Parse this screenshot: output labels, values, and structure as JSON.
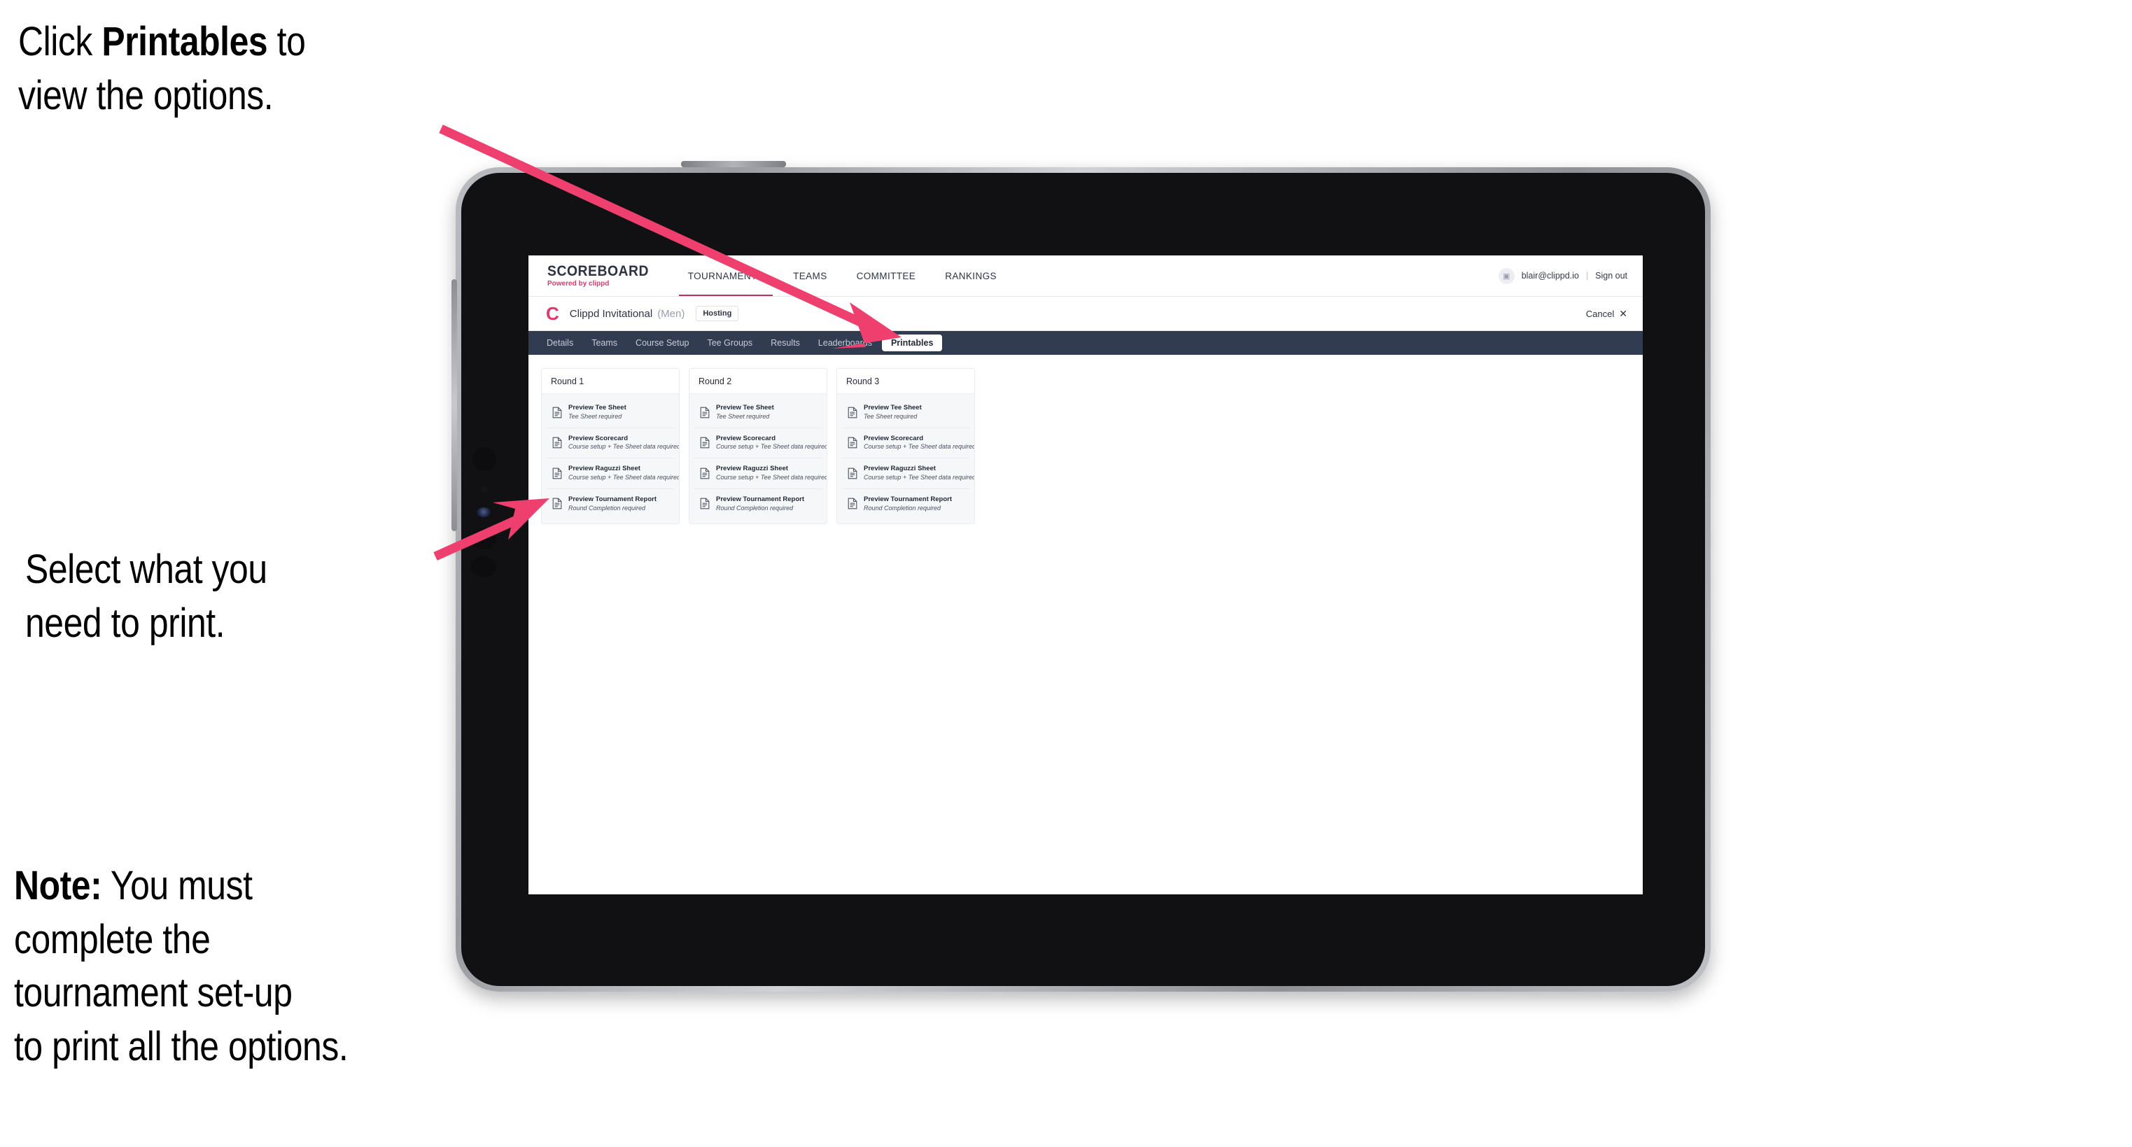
{
  "callouts": {
    "click_line1_prefix": "Click ",
    "click_bold": "Printables",
    "click_line1_suffix": " to",
    "click_line2": "view the options.",
    "select_line1": "Select what you",
    "select_line2": " need to print.",
    "note_bold": "Note:",
    "note_line1_rest": " You must",
    "note_line2": "complete the",
    "note_line3": "tournament set-up",
    "note_line4": "to print all the options."
  },
  "app": {
    "logo": {
      "main": "SCOREBOARD",
      "sub_prefix": "Powered by ",
      "sub_brand": "clippd"
    },
    "topnav": {
      "items": [
        {
          "label": "TOURNAMENTS",
          "active": true
        },
        {
          "label": "TEAMS",
          "active": false
        },
        {
          "label": "COMMITTEE",
          "active": false
        },
        {
          "label": "RANKINGS",
          "active": false
        }
      ],
      "avatar_glyph": "▣",
      "user_email": "blair@clippd.io",
      "separator": "|",
      "sign_out": "Sign out"
    },
    "tournament_bar": {
      "logo_letter": "C",
      "name": "Clippd Invitational",
      "gender": "(Men)",
      "badge": "Hosting",
      "cancel_label": "Cancel",
      "cancel_icon": "✕"
    },
    "section_tabs": [
      {
        "label": "Details",
        "active": false
      },
      {
        "label": "Teams",
        "active": false
      },
      {
        "label": "Course Setup",
        "active": false
      },
      {
        "label": "Tee Groups",
        "active": false
      },
      {
        "label": "Results",
        "active": false
      },
      {
        "label": "Leaderboards",
        "active": false
      },
      {
        "label": "Printables",
        "active": true
      }
    ],
    "rounds": [
      {
        "title": "Round 1",
        "items": [
          {
            "title": "Preview Tee Sheet",
            "sub": "Tee Sheet required"
          },
          {
            "title": "Preview Scorecard",
            "sub": "Course setup + Tee Sheet data required"
          },
          {
            "title": "Preview Raguzzi Sheet",
            "sub": "Course setup + Tee Sheet data required"
          },
          {
            "title": "Preview Tournament Report",
            "sub": "Round Completion required"
          }
        ]
      },
      {
        "title": "Round 2",
        "items": [
          {
            "title": "Preview Tee Sheet",
            "sub": "Tee Sheet required"
          },
          {
            "title": "Preview Scorecard",
            "sub": "Course setup + Tee Sheet data required"
          },
          {
            "title": "Preview Raguzzi Sheet",
            "sub": "Course setup + Tee Sheet data required"
          },
          {
            "title": "Preview Tournament Report",
            "sub": "Round Completion required"
          }
        ]
      },
      {
        "title": "Round 3",
        "items": [
          {
            "title": "Preview Tee Sheet",
            "sub": "Tee Sheet required"
          },
          {
            "title": "Preview Scorecard",
            "sub": "Course setup + Tee Sheet data required"
          },
          {
            "title": "Preview Raguzzi Sheet",
            "sub": "Course setup + Tee Sheet data required"
          },
          {
            "title": "Preview Tournament Report",
            "sub": "Round Completion required"
          }
        ]
      }
    ]
  },
  "colors": {
    "accent_pink": "#ef3f6e",
    "nav_navy": "#323c50",
    "brand_red": "#e0376a",
    "tab_underline": "#b5355e"
  }
}
